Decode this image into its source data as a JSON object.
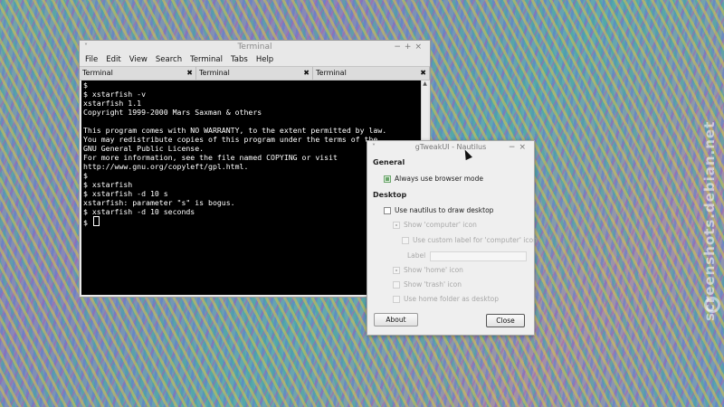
{
  "watermark": {
    "text": "screenshots.debian.net"
  },
  "terminal": {
    "title": "Terminal",
    "menu": [
      "File",
      "Edit",
      "View",
      "Search",
      "Terminal",
      "Tabs",
      "Help"
    ],
    "tabs": [
      "Terminal",
      "Terminal",
      "Terminal"
    ],
    "lines": [
      "$",
      "$ xstarfish -v",
      "xstarfish 1.1",
      "Copyright 1999-2000 Mars Saxman & others",
      "",
      "This program comes with NO WARRANTY, to the extent permitted by law.",
      "You may redistribute copies of this program under the terms of the",
      "GNU General Public License.",
      "For more information, see the file named COPYING or visit",
      "http://www.gnu.org/copyleft/gpl.html.",
      "$",
      "$ xstarfish",
      "$ xstarfish -d 10 s",
      "xstarfish: parameter \"s\" is bogus.",
      "$ xstarfish -d 10 seconds"
    ],
    "prompt": "$ "
  },
  "dialog": {
    "title": "gTweakUI - Nautilus",
    "general_heading": "General",
    "browser_mode": "Always use browser mode",
    "desktop_heading": "Desktop",
    "draw_desktop": "Use nautilus to draw desktop",
    "show_computer": "Show 'computer' icon",
    "custom_label": "Use custom label for 'computer' icon",
    "label_caption": "Label",
    "label_value": "",
    "show_home": "Show 'home' icon",
    "show_trash": "Show 'trash' icon",
    "home_as_desktop": "Use home folder as desktop",
    "about_button": "About",
    "close_button": "Close"
  }
}
